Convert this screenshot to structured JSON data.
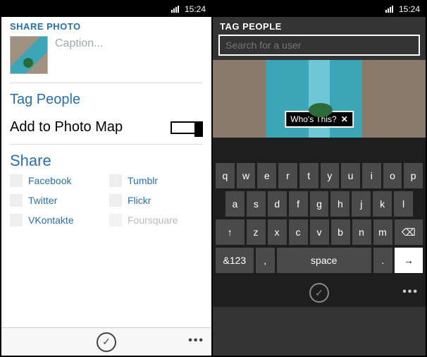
{
  "statusbar": {
    "time": "15:24"
  },
  "left": {
    "header": "SHARE PHOTO",
    "caption_placeholder": "Caption...",
    "tag_people": "Tag People",
    "add_to_map": "Add to Photo Map",
    "share_header": "Share",
    "share_targets": {
      "facebook": "Facebook",
      "tumblr": "Tumblr",
      "twitter": "Twitter",
      "flickr": "Flickr",
      "vkontakte": "VKontakte",
      "foursquare": "Foursquare"
    },
    "appbar": {
      "confirm_glyph": "✓",
      "more_glyph": "•••"
    }
  },
  "right": {
    "header": "TAG PEOPLE",
    "search_placeholder": "Search for a user",
    "tag_label": "Who's This?",
    "tag_close": "✕",
    "keyboard": {
      "row1": [
        "q",
        "w",
        "e",
        "r",
        "t",
        "y",
        "u",
        "i",
        "o",
        "p"
      ],
      "row2": [
        "a",
        "s",
        "d",
        "f",
        "g",
        "h",
        "j",
        "k",
        "l"
      ],
      "row3_shift": "↑",
      "row3": [
        "z",
        "x",
        "c",
        "v",
        "b",
        "n",
        "m"
      ],
      "row3_back": "⌫",
      "row4_sym": "&123",
      "row4_comma": ",",
      "row4_space": "space",
      "row4_period": ".",
      "row4_enter": "→"
    },
    "appbar": {
      "confirm_glyph": "✓",
      "more_glyph": "•••"
    }
  }
}
